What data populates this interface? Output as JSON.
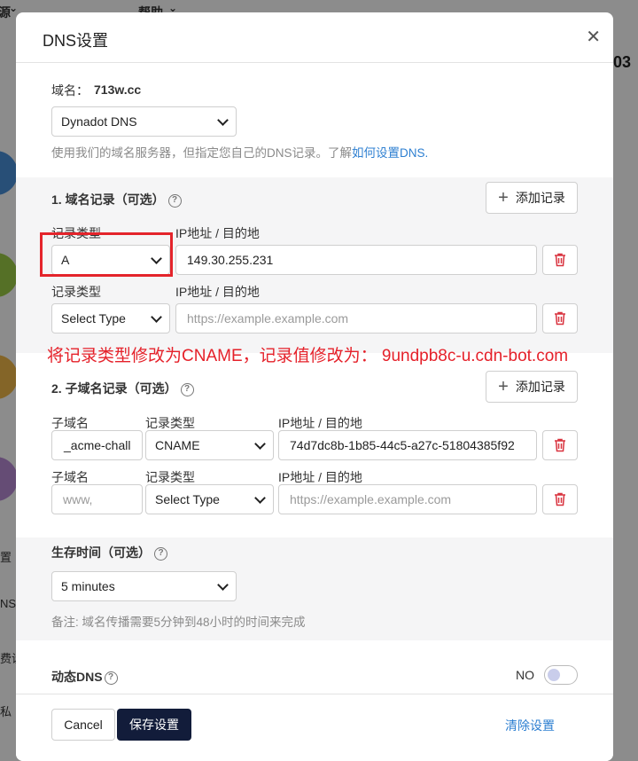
{
  "background": {
    "menu_left": "源",
    "menu_help": "帮助",
    "corner_number": "03",
    "left_labels": [
      "置",
      "NS设",
      "费设",
      "私"
    ]
  },
  "dialog": {
    "title": "DNS设置",
    "domain_label": "域名：",
    "domain_value": "713w.cc",
    "dns_provider": "Dynadot DNS",
    "description_prefix": "使用我们的域名服务器，但指定您自己的DNS记录。了解",
    "description_link": "如何设置DNS",
    "description_suffix": "."
  },
  "domain_records": {
    "heading": "1. 域名记录（可选）",
    "add_label": "添加记录",
    "type_header": "记录类型",
    "value_header": "IP地址 / 目的地",
    "rows": [
      {
        "type": "A",
        "value": "149.30.255.231",
        "placeholder": ""
      },
      {
        "type": "Select Type",
        "value": "",
        "placeholder": "https://example.example.com"
      }
    ]
  },
  "annotation": "将记录类型修改为CNAME，记录值修改为： 9undpb8c-u.cdn-bot.com",
  "subdomain_records": {
    "heading": "2. 子域名记录（可选）",
    "add_label": "添加记录",
    "sub_header": "子域名",
    "type_header": "记录类型",
    "value_header": "IP地址 / 目的地",
    "rows": [
      {
        "sub": "_acme-chall",
        "sub_placeholder": "",
        "type": "CNAME",
        "value": "74d7dc8b-1b85-44c5-a27c-51804385f92",
        "placeholder": ""
      },
      {
        "sub": "",
        "sub_placeholder": "www,",
        "type": "Select Type",
        "value": "",
        "placeholder": "https://example.example.com"
      }
    ]
  },
  "ttl": {
    "heading": "生存时间（可选）",
    "value": "5 minutes",
    "note": "备注: 域名传播需要5分钟到48小时的时间来完成"
  },
  "dynamic_dns": {
    "label": "动态DNS",
    "state": "NO"
  },
  "footer": {
    "cancel": "Cancel",
    "save": "保存设置",
    "clear": "清除设置"
  },
  "help_glyph": "?",
  "close_glyph": "✕",
  "plus_glyph": "+",
  "colors": {
    "primary_button": "#121c3a",
    "link": "#2d7fd1",
    "annotation": "#e5212a",
    "trash_icon": "#d9333f"
  }
}
